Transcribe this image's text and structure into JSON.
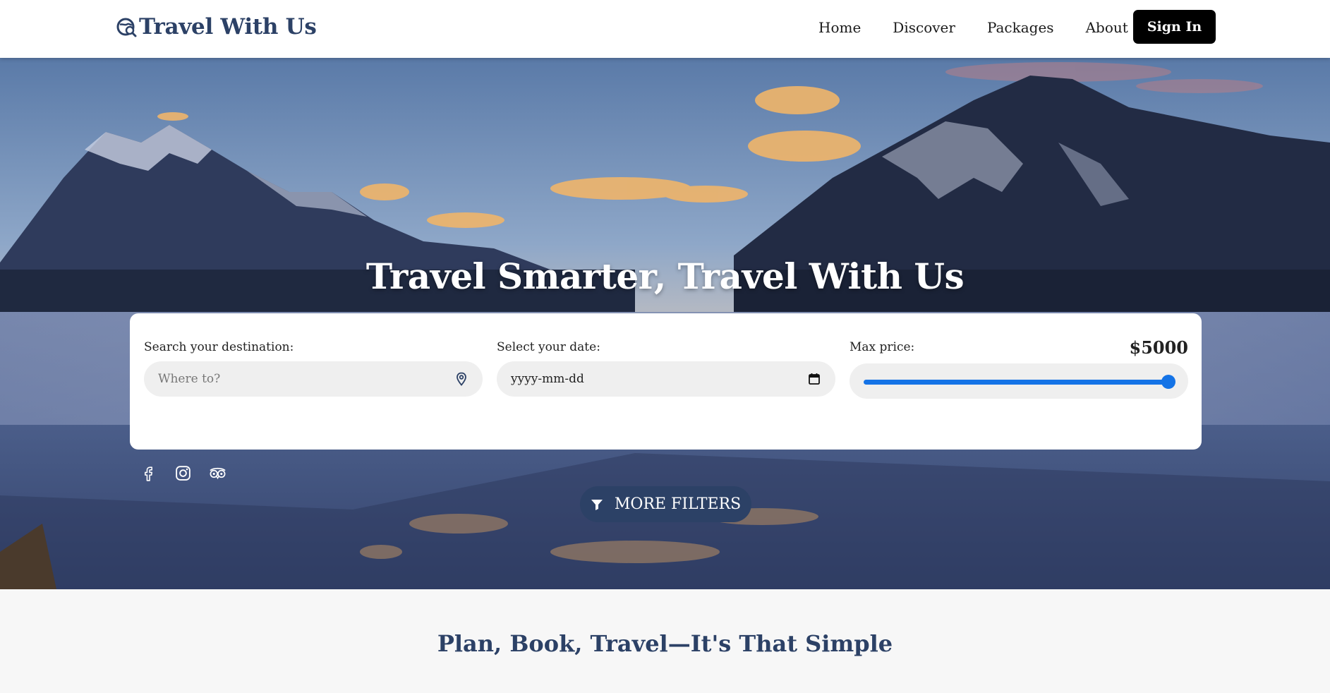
{
  "brand": {
    "name": "Travel With Us",
    "icon": "globe-search-icon",
    "color": "#2c4166"
  },
  "nav": {
    "links": [
      {
        "label": "Home"
      },
      {
        "label": "Discover"
      },
      {
        "label": "Packages"
      },
      {
        "label": "About"
      }
    ],
    "signin_label": "Sign In"
  },
  "hero": {
    "title": "Travel Smarter, Travel With Us",
    "background": "mountain-lake-sunset-photo"
  },
  "search": {
    "destination": {
      "label": "Search your destination:",
      "placeholder": "Where to?",
      "icon": "map-pin-icon"
    },
    "date": {
      "label": "Select your date:",
      "value": "yyyy-mm-dd",
      "icon": "calendar-icon"
    },
    "price": {
      "label": "Max price:",
      "value_label": "$5000",
      "slider_fraction": 1.0,
      "accent": "#1473e6"
    }
  },
  "filters_button": {
    "label": "MORE FILTERS",
    "icon": "funnel-icon"
  },
  "socials": [
    {
      "icon": "facebook-icon"
    },
    {
      "icon": "instagram-icon"
    },
    {
      "icon": "tripadvisor-icon"
    }
  ],
  "section": {
    "title": "Plan, Book, Travel—It's That Simple"
  }
}
